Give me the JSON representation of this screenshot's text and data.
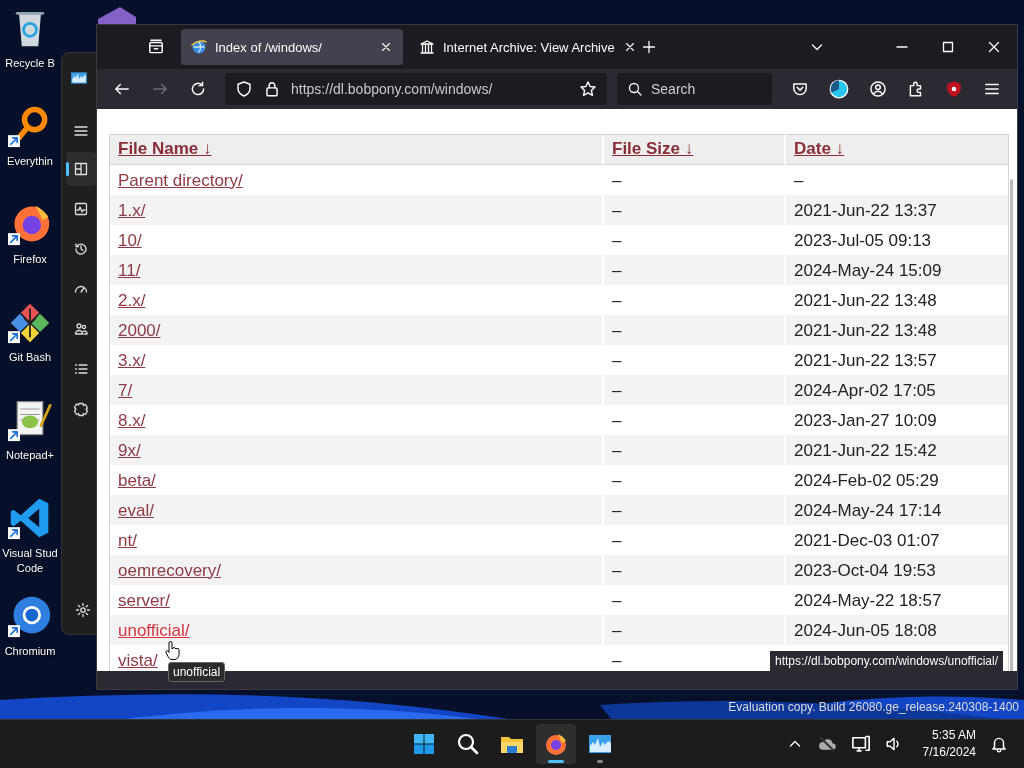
{
  "desktop_icons": [
    {
      "kind": "recycle",
      "label": "Recycle B"
    },
    {
      "kind": "everything",
      "label": "Everythin"
    },
    {
      "kind": "firefox",
      "label": "Firefox"
    },
    {
      "kind": "git",
      "label": "Git Bash"
    },
    {
      "kind": "notepad",
      "label": "Notepad+"
    },
    {
      "kind": "vscode",
      "label": "Visual Stud Code"
    },
    {
      "kind": "chromium",
      "label": "Chromium"
    }
  ],
  "task_manager": {
    "nav": [
      {
        "kind": "processes",
        "selected": true
      },
      {
        "kind": "performance",
        "selected": false
      },
      {
        "kind": "history",
        "selected": false
      },
      {
        "kind": "startup",
        "selected": false
      },
      {
        "kind": "users",
        "selected": false
      },
      {
        "kind": "details",
        "selected": false
      },
      {
        "kind": "services",
        "selected": false
      }
    ]
  },
  "browser": {
    "tabs": [
      {
        "kind": "globe",
        "title": "Index of /windows/",
        "selected": true
      },
      {
        "kind": "archive",
        "title": "Internet Archive: View Archive",
        "selected": false
      }
    ],
    "forward": {
      "disabled": true
    },
    "address": {
      "url": "https://dl.bobpony.com/windows/"
    },
    "search": {
      "placeholder": "Search"
    },
    "table": {
      "columns": [
        "File Name ↓",
        "File Size ↓",
        "Date ↓"
      ],
      "rows": [
        {
          "name": "Parent directory/",
          "size": "–",
          "date": "–",
          "hovered": false
        },
        {
          "name": "1.x/",
          "size": "–",
          "date": "2021-Jun-22 13:37",
          "hovered": false
        },
        {
          "name": "10/",
          "size": "–",
          "date": "2023-Jul-05 09:13",
          "hovered": false
        },
        {
          "name": "11/",
          "size": "–",
          "date": "2024-May-24 15:09",
          "hovered": false
        },
        {
          "name": "2.x/",
          "size": "–",
          "date": "2021-Jun-22 13:48",
          "hovered": false
        },
        {
          "name": "2000/",
          "size": "–",
          "date": "2021-Jun-22 13:48",
          "hovered": false
        },
        {
          "name": "3.x/",
          "size": "–",
          "date": "2021-Jun-22 13:57",
          "hovered": false
        },
        {
          "name": "7/",
          "size": "–",
          "date": "2024-Apr-02 17:05",
          "hovered": false
        },
        {
          "name": "8.x/",
          "size": "–",
          "date": "2023-Jan-27 10:09",
          "hovered": false
        },
        {
          "name": "9x/",
          "size": "–",
          "date": "2021-Jun-22 15:42",
          "hovered": false
        },
        {
          "name": "beta/",
          "size": "–",
          "date": "2024-Feb-02 05:29",
          "hovered": false
        },
        {
          "name": "eval/",
          "size": "–",
          "date": "2024-May-24 17:14",
          "hovered": false
        },
        {
          "name": "nt/",
          "size": "–",
          "date": "2021-Dec-03 01:07",
          "hovered": false
        },
        {
          "name": "oemrecovery/",
          "size": "–",
          "date": "2023-Oct-04 19:53",
          "hovered": false
        },
        {
          "name": "server/",
          "size": "–",
          "date": "2024-May-22 18:57",
          "hovered": false
        },
        {
          "name": "unofficial/",
          "size": "–",
          "date": "2024-Jun-05 18:08",
          "hovered": true
        },
        {
          "name": "vista/",
          "size": "–",
          "hovered": false
        }
      ]
    },
    "tooltip": "unofficial",
    "status_url": "https://dl.bobpony.com/windows/unofficial/"
  },
  "watermark": "Evaluation copy. Build 26080.ge_release.240308-1400",
  "taskbar": {
    "apps": [
      {
        "kind": "start",
        "active": false,
        "running": false
      },
      {
        "kind": "search",
        "active": false,
        "running": false
      },
      {
        "kind": "explorer",
        "active": false,
        "running": false
      },
      {
        "kind": "firefox",
        "active": true,
        "running": true
      },
      {
        "kind": "taskmanager",
        "active": false,
        "running": true
      }
    ],
    "time": "5:35 AM",
    "date": "7/16/2024"
  }
}
